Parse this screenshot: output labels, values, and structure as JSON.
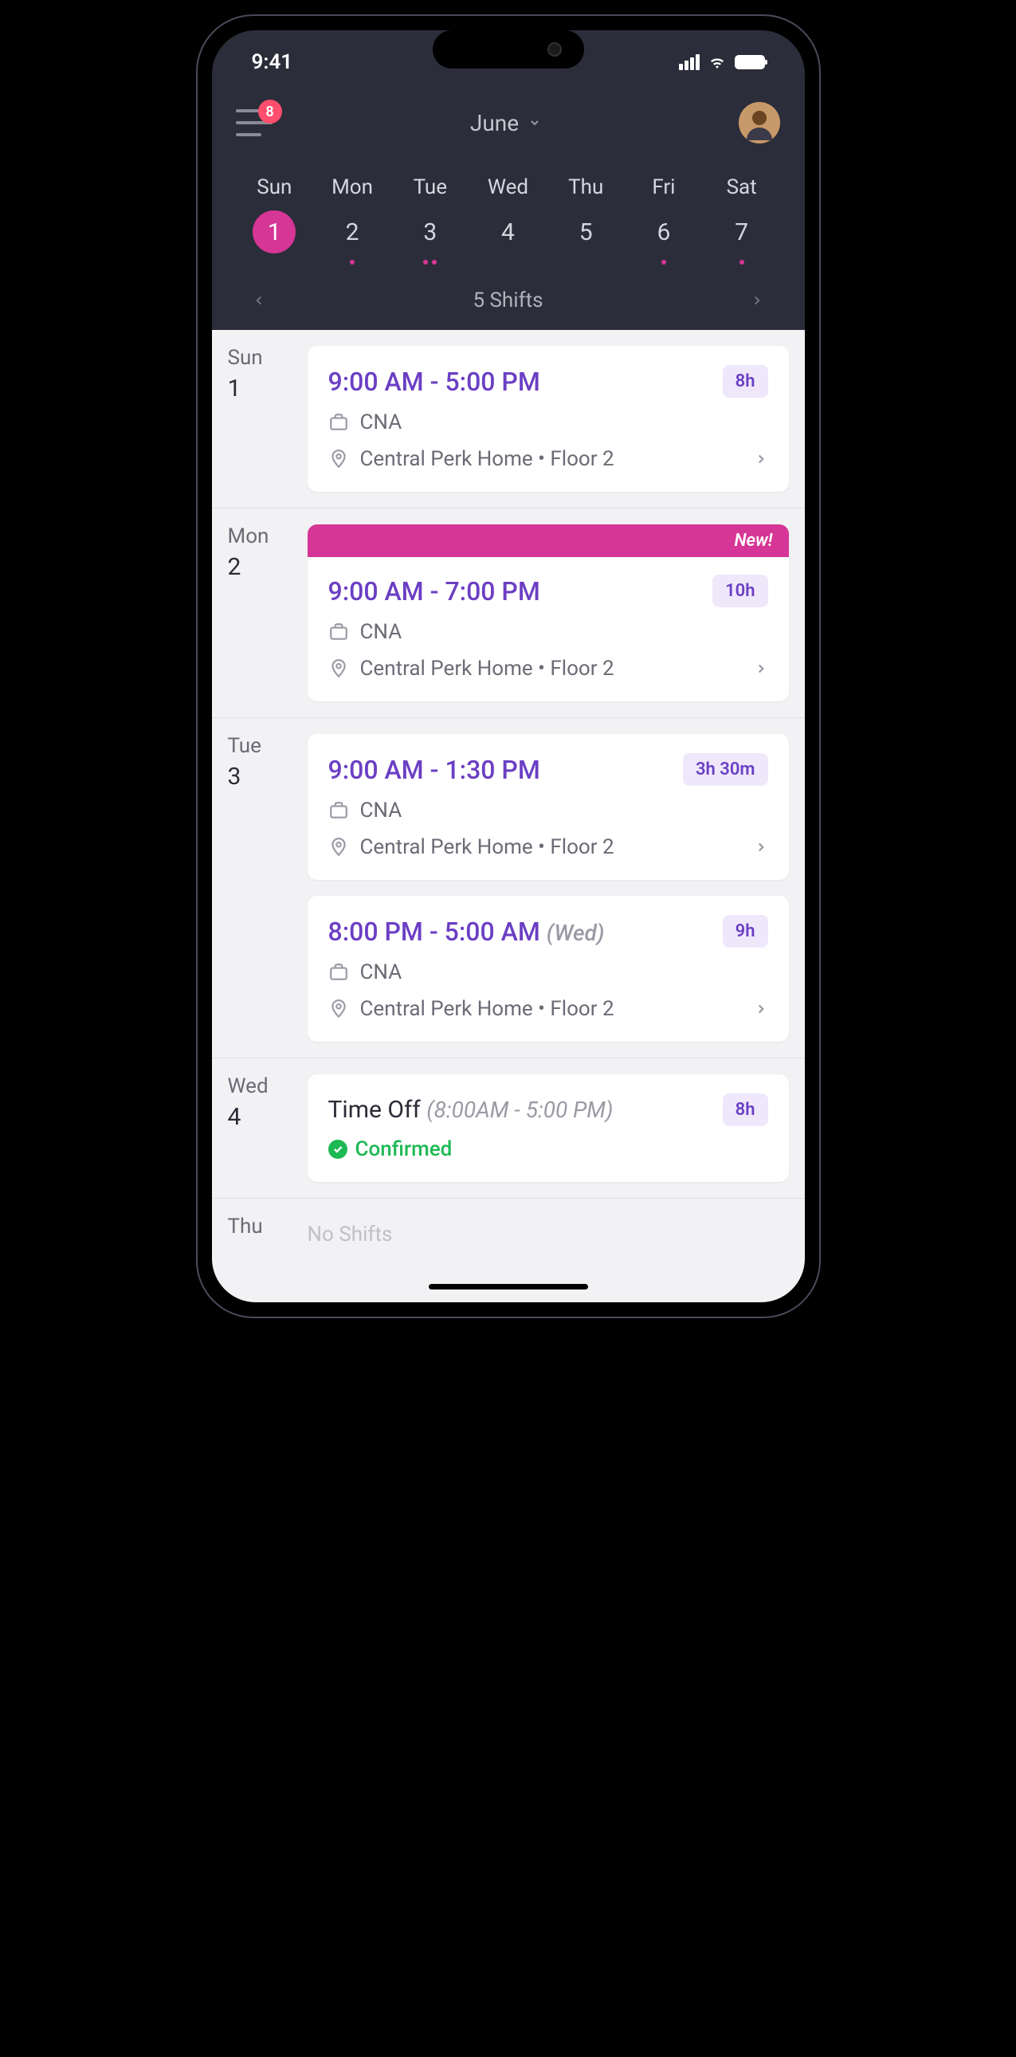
{
  "status": {
    "time": "9:41"
  },
  "header": {
    "badge": "8",
    "month": "June"
  },
  "week": {
    "days": [
      {
        "name": "Sun",
        "num": "1",
        "selected": true,
        "dots": 0
      },
      {
        "name": "Mon",
        "num": "2",
        "selected": false,
        "dots": 1
      },
      {
        "name": "Tue",
        "num": "3",
        "selected": false,
        "dots": 2
      },
      {
        "name": "Wed",
        "num": "4",
        "selected": false,
        "dots": 0
      },
      {
        "name": "Thu",
        "num": "5",
        "selected": false,
        "dots": 0
      },
      {
        "name": "Fri",
        "num": "6",
        "selected": false,
        "dots": 1
      },
      {
        "name": "Sat",
        "num": "7",
        "selected": false,
        "dots": 1
      }
    ],
    "shifts_label": "5 Shifts"
  },
  "list": [
    {
      "day_name": "Sun",
      "day_num": "1",
      "cards": [
        {
          "type": "shift",
          "new": false,
          "time": "9:00 AM - 5:00 PM",
          "overnight": "",
          "duration": "8h",
          "role": "CNA",
          "location": "Central Perk Home • Floor 2"
        }
      ]
    },
    {
      "day_name": "Mon",
      "day_num": "2",
      "cards": [
        {
          "type": "shift",
          "new": true,
          "new_label": "New!",
          "time": "9:00 AM - 7:00 PM",
          "overnight": "",
          "duration": "10h",
          "role": "CNA",
          "location": "Central Perk Home • Floor 2"
        }
      ]
    },
    {
      "day_name": "Tue",
      "day_num": "3",
      "cards": [
        {
          "type": "shift",
          "new": false,
          "time": "9:00 AM - 1:30 PM",
          "overnight": "",
          "duration": "3h 30m",
          "role": "CNA",
          "location": "Central Perk Home • Floor 2"
        },
        {
          "type": "shift",
          "new": false,
          "time": "8:00 PM - 5:00 AM",
          "overnight": "(Wed)",
          "duration": "9h",
          "role": "CNA",
          "location": "Central Perk Home • Floor 2"
        }
      ]
    },
    {
      "day_name": "Wed",
      "day_num": "4",
      "cards": [
        {
          "type": "timeoff",
          "title": "Time Off",
          "sub": "(8:00AM - 5:00 PM)",
          "duration": "8h",
          "status": "Confirmed"
        }
      ]
    },
    {
      "day_name": "Thu",
      "day_num": "",
      "cards": [
        {
          "type": "empty",
          "text": "No Shifts"
        }
      ]
    }
  ]
}
